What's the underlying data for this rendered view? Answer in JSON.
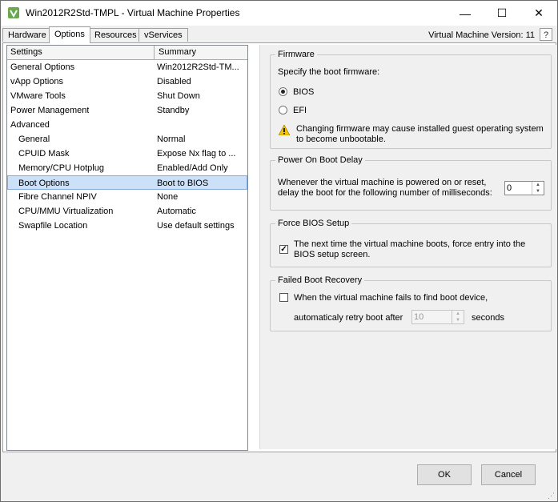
{
  "window": {
    "title": "Win2012R2Std-TMPL - Virtual Machine Properties"
  },
  "titlebar_buttons": {
    "minimize": "—",
    "maximize": "☐",
    "close": "✕"
  },
  "tabs": [
    {
      "label": "Hardware",
      "active": false
    },
    {
      "label": "Options",
      "active": true
    },
    {
      "label": "Resources",
      "active": false
    },
    {
      "label": "vServices",
      "active": false
    }
  ],
  "vm_version": "Virtual Machine Version: 11",
  "help_label": "?",
  "settings_list": {
    "headers": {
      "settings": "Settings",
      "summary": "Summary"
    },
    "rows": [
      {
        "setting": "General Options",
        "summary": "Win2012R2Std-TM..."
      },
      {
        "setting": "vApp Options",
        "summary": "Disabled"
      },
      {
        "setting": "VMware Tools",
        "summary": "Shut Down"
      },
      {
        "setting": "Power Management",
        "summary": "Standby"
      },
      {
        "setting": "Advanced",
        "summary": ""
      },
      {
        "setting": "General",
        "summary": "Normal"
      },
      {
        "setting": "CPUID Mask",
        "summary": "Expose Nx flag to ..."
      },
      {
        "setting": "Memory/CPU Hotplug",
        "summary": "Enabled/Add Only"
      },
      {
        "setting": "Boot Options",
        "summary": "Boot to BIOS",
        "selected": true
      },
      {
        "setting": "Fibre Channel NPIV",
        "summary": "None"
      },
      {
        "setting": "CPU/MMU Virtualization",
        "summary": "Automatic"
      },
      {
        "setting": "Swapfile Location",
        "summary": "Use default settings"
      }
    ]
  },
  "firmware": {
    "title": "Firmware",
    "prompt": "Specify the boot firmware:",
    "options": [
      {
        "label": "BIOS",
        "selected": true
      },
      {
        "label": "EFI",
        "selected": false
      }
    ],
    "warning_line1": "Changing firmware may cause installed guest operating system",
    "warning_line2": "to become unbootable."
  },
  "boot_delay": {
    "title": "Power On Boot Delay",
    "line1": "Whenever the virtual machine is powered on or reset,",
    "line2": "delay the boot for the following number of milliseconds:",
    "value": "0"
  },
  "force_bios": {
    "title": "Force BIOS Setup",
    "checked": true,
    "line1": "The next time the virtual machine boots, force entry into the",
    "line2": "BIOS setup screen."
  },
  "failed_boot": {
    "title": "Failed Boot Recovery",
    "checked": false,
    "line1": "When the virtual machine fails to find boot device,",
    "retry_prefix": "automaticaly retry boot after",
    "retry_value": "10",
    "retry_suffix": "seconds"
  },
  "buttons": {
    "ok": "OK",
    "cancel": "Cancel"
  },
  "colors": {
    "selection": "#cce0f7",
    "selection_border": "#84acdd",
    "warning": "#f5c400"
  }
}
